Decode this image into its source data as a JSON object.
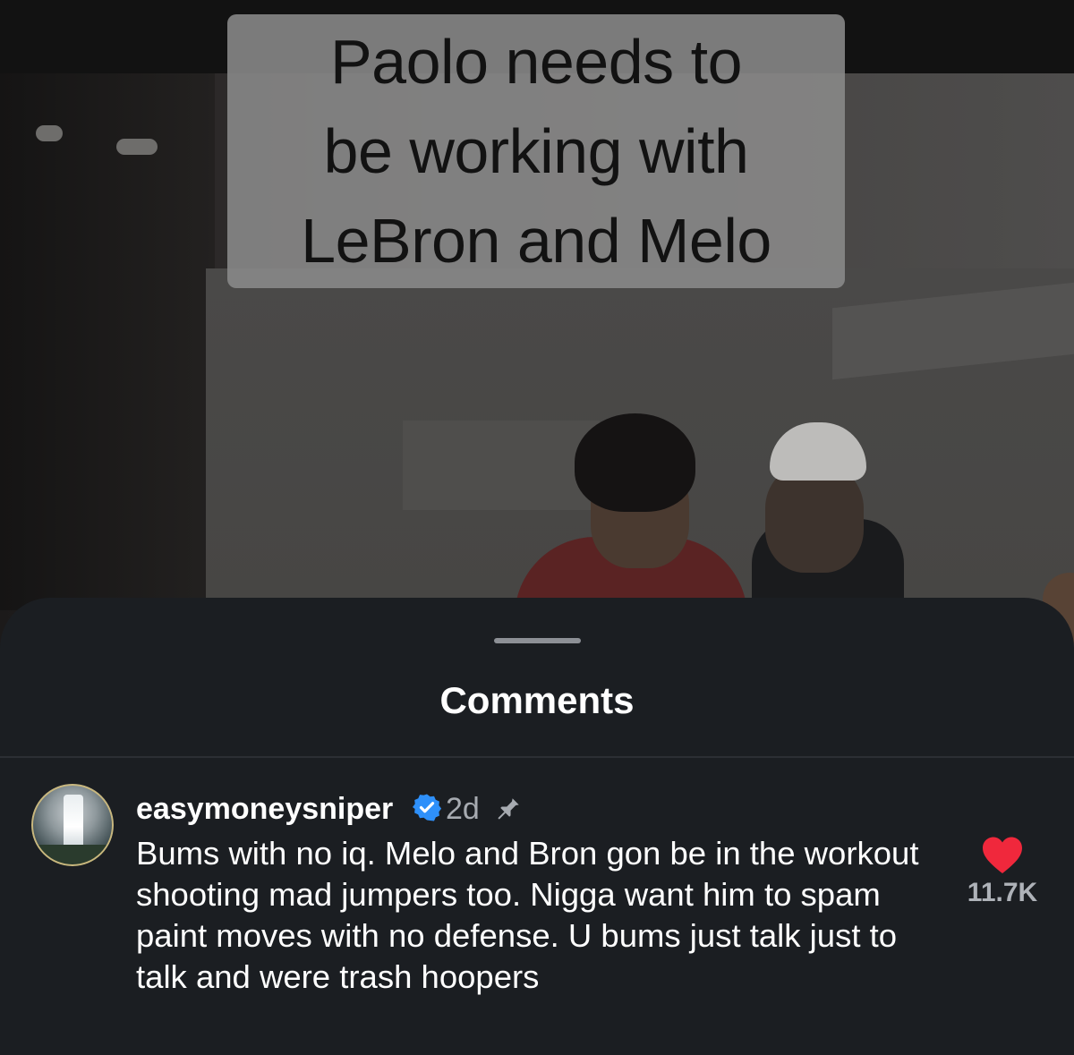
{
  "video": {
    "caption": "Paolo needs to\nbe working with\nLeBron and Melo"
  },
  "comments_sheet": {
    "title": "Comments",
    "comments": [
      {
        "username": "easymoneysniper",
        "verified": true,
        "time": "2d",
        "pinned": true,
        "text": "Bums with no iq. Melo and Bron gon be in the workout shooting mad jumpers too. Nigga want him to spam paint moves with no defense. U bums just talk just to talk and were trash hoopers",
        "liked": true,
        "like_count": "11.7K"
      }
    ]
  },
  "icons": {
    "verified": "verified-badge-icon",
    "pin": "pin-icon",
    "like": "heart-icon"
  },
  "colors": {
    "like_active": "#f0283c",
    "verified": "#2e90fa",
    "sheet_background": "#1b1e22"
  }
}
